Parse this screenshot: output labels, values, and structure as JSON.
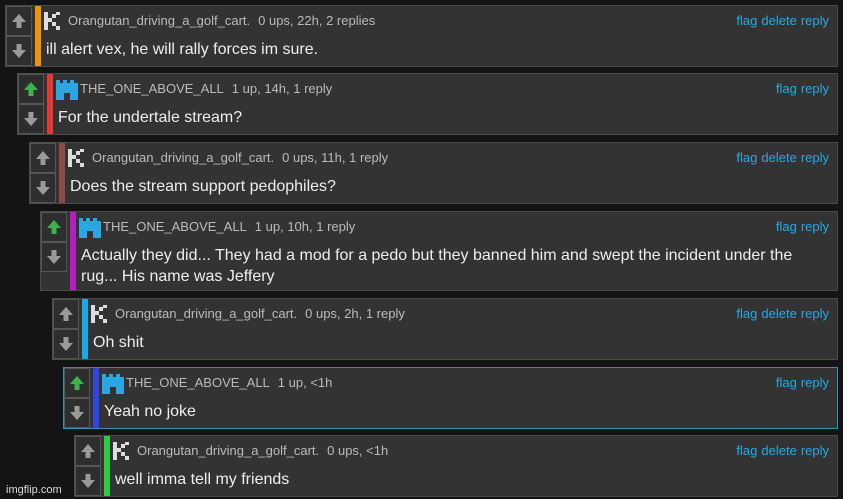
{
  "comments": [
    {
      "user": "Orangutan_driving_a_golf_cart.",
      "stats": "0 ups, 22h, 2 replies",
      "text": "ill alert vex, he will rally forces im sure.",
      "bar_color": "#f0930a",
      "avatar": "golfcart-avatar-icon",
      "upvoted": false,
      "actions": [
        "flag",
        "delete",
        "reply"
      ]
    },
    {
      "user": "THE_ONE_ABOVE_ALL",
      "stats": "1 up, 14h, 1 reply",
      "text": "For the undertale stream?",
      "bar_color": "#e53935",
      "avatar": "castle-avatar-icon",
      "upvoted": true,
      "actions": [
        "flag",
        "reply"
      ]
    },
    {
      "user": "Orangutan_driving_a_golf_cart.",
      "stats": "0 ups, 11h, 1 reply",
      "text": "Does the stream support pedophiles?",
      "bar_color": "#8d4a4a",
      "avatar": "golfcart-avatar-icon",
      "upvoted": false,
      "actions": [
        "flag",
        "delete",
        "reply"
      ]
    },
    {
      "user": "THE_ONE_ABOVE_ALL",
      "stats": "1 up, 10h, 1 reply",
      "text": "Actually they did... They had a mod for a pedo but they banned him and swept the incident under the rug... His name was Jeffery",
      "bar_color": "#b41fc0",
      "avatar": "castle-avatar-icon",
      "upvoted": true,
      "actions": [
        "flag",
        "reply"
      ]
    },
    {
      "user": "Orangutan_driving_a_golf_cart.",
      "stats": "0 ups, 2h, 1 reply",
      "text": "Oh shit",
      "bar_color": "#1ea7e6",
      "avatar": "golfcart-avatar-icon",
      "upvoted": false,
      "actions": [
        "flag",
        "delete",
        "reply"
      ]
    },
    {
      "user": "THE_ONE_ABOVE_ALL",
      "stats": "1 up, <1h",
      "text": "Yeah no joke",
      "bar_color": "#2f47e0",
      "avatar": "castle-avatar-icon",
      "upvoted": true,
      "actions": [
        "flag",
        "reply"
      ]
    },
    {
      "user": "Orangutan_driving_a_golf_cart.",
      "stats": "0 ups, <1h",
      "text": "well imma tell my friends",
      "bar_color": "#2ecc40",
      "avatar": "golfcart-avatar-icon",
      "upvoted": false,
      "actions": [
        "flag",
        "delete",
        "reply"
      ]
    }
  ],
  "watermark": "imgflip.com"
}
